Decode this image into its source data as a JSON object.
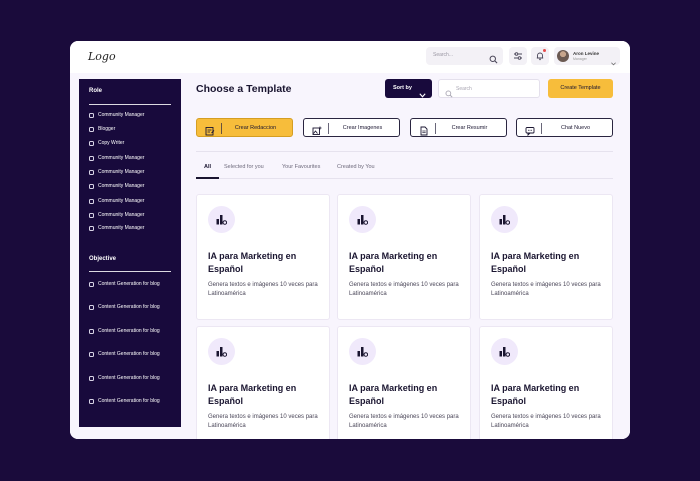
{
  "header": {
    "logo": "Logo",
    "search_placeholder": "Search...",
    "user_name": "Aron Levine",
    "user_role": "Manager"
  },
  "sidebar": {
    "role_heading": "Role",
    "roles": [
      "Community Manager",
      "Blogger",
      "Copy Writer",
      "Community Manager",
      "Community Manager",
      "Community Manager",
      "Community Manager",
      "Community Manager",
      "Community Manager"
    ],
    "objective_heading": "Objective",
    "objectives": [
      "Content Generation for blog",
      "Content Generation for blog",
      "Content Generation for blog",
      "Content Generation for blog",
      "Content Generation for blog",
      "Content Generation for blog"
    ]
  },
  "main": {
    "title": "Choose a Template",
    "sort_label": "Sort by",
    "search_placeholder": "Search",
    "create_label": "Create Template",
    "actions": [
      {
        "label": "Crear Redaccion",
        "icon": "edit-note-icon",
        "primary": true
      },
      {
        "label": "Crear Imagenes",
        "icon": "image-add-icon",
        "primary": false
      },
      {
        "label": "Crear Resumir",
        "icon": "document-icon",
        "primary": false
      },
      {
        "label": "Chat Nuevo",
        "icon": "chat-icon",
        "primary": false
      }
    ],
    "tabs": [
      "All",
      "Selected for you",
      "Your Favourites",
      "Created by You"
    ],
    "active_tab": "All",
    "cards": [
      {
        "title": "IA para Marketing en Español",
        "desc": "Genera textos e imágenes 10 veces para Latinoamérica",
        "icon": "chart-icon"
      },
      {
        "title": "IA para Marketing en Español",
        "desc": "Genera textos e imágenes 10 veces para Latinoamérica",
        "icon": "chart-icon"
      },
      {
        "title": "IA para Marketing en Español",
        "desc": "Genera textos e imágenes 10 veces para Latinoamérica",
        "icon": "chart-icon"
      },
      {
        "title": "IA para Marketing en Español",
        "desc": "Genera textos e imágenes 10 veces para Latinoamérica",
        "icon": "chart-icon"
      },
      {
        "title": "IA para Marketing en Español",
        "desc": "Genera textos e imágenes 10 veces para Latinoamérica",
        "icon": "chart-icon"
      },
      {
        "title": "IA para Marketing en Español",
        "desc": "Genera textos e imágenes 10 veces para Latinoamérica",
        "icon": "chart-icon"
      }
    ]
  },
  "colors": {
    "background": "#1a0b3b",
    "sidebar": "#180a3c",
    "accent": "#f7bd3b",
    "content_bg": "#f8f5fd",
    "icon_bg": "#f0e9fb"
  }
}
